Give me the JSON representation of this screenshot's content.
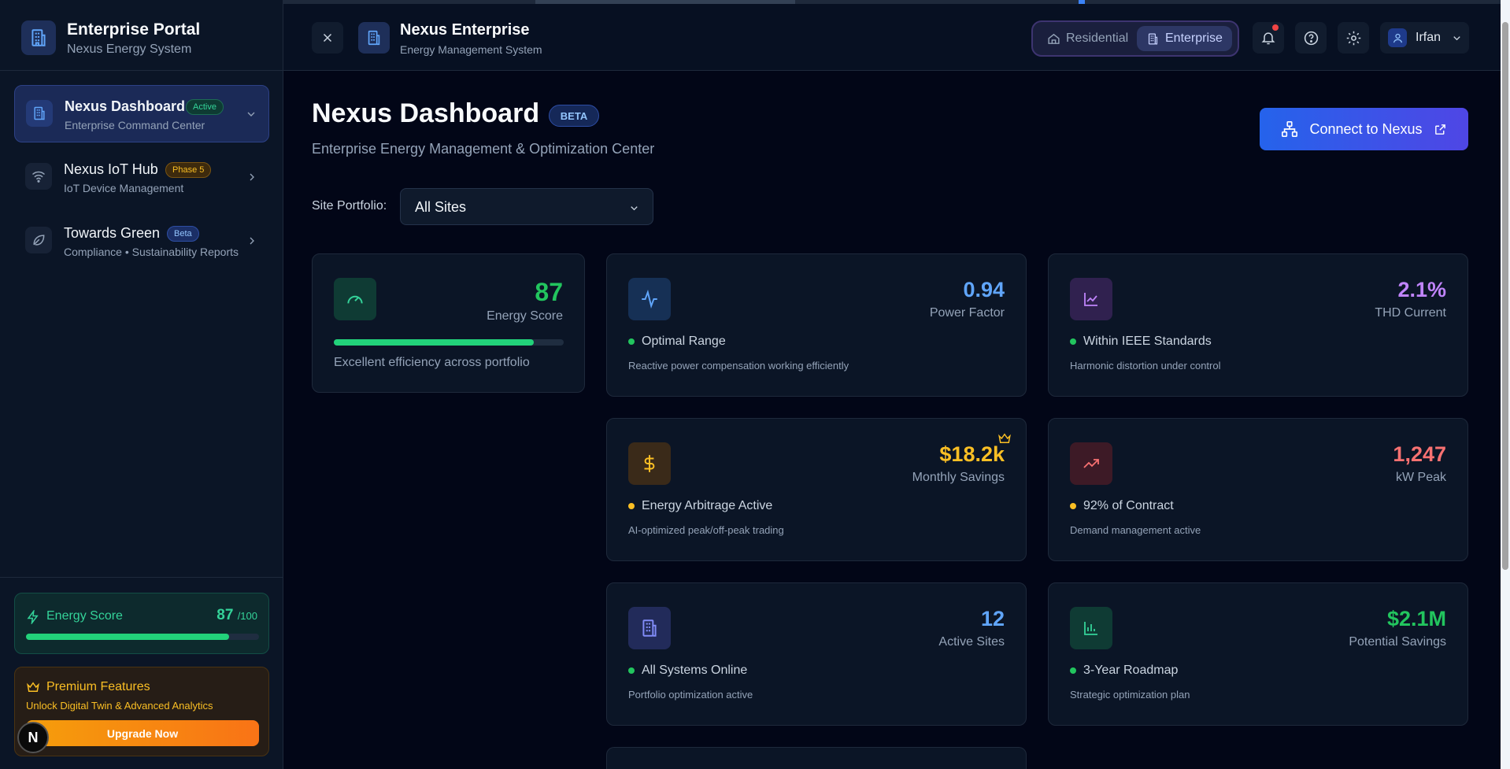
{
  "sidebar": {
    "title": "Enterprise Portal",
    "subtitle": "Nexus Energy System",
    "items": [
      {
        "label": "Nexus Dashboard",
        "badge": "Active",
        "desc": "Enterprise Command Center"
      },
      {
        "label": "Nexus IoT Hub",
        "badge": "Phase 5",
        "desc": "IoT Device Management"
      },
      {
        "label": "Towards Green",
        "badge": "Beta",
        "desc": "Compliance • Sustainability Reports"
      }
    ],
    "energy_score": {
      "label": "Energy Score",
      "value": "87",
      "max": "/100",
      "progress_pct": 87
    },
    "premium": {
      "title": "Premium Features",
      "desc": "Unlock Digital Twin & Advanced Analytics",
      "button": "Upgrade Now"
    },
    "avatar_letter": "N"
  },
  "header": {
    "title": "Nexus Enterprise",
    "subtitle": "Energy Management System",
    "modes": [
      "Residential",
      "Enterprise"
    ],
    "selected_mode": "Enterprise",
    "user": "Irfan"
  },
  "main": {
    "title": "Nexus Dashboard",
    "badge": "BETA",
    "subtitle": "Enterprise Energy Management & Optimization Center",
    "connect_button": "Connect to Nexus",
    "site_label": "Site Portfolio:",
    "site_value": "All Sites",
    "score_card": {
      "value": "87",
      "label": "Energy Score",
      "progress_pct": 87,
      "note": "Excellent efficiency across portfolio"
    },
    "cards": [
      {
        "value": "0.94",
        "label": "Power Factor",
        "status": "Optimal Range",
        "note": "Reactive power compensation working efficiently"
      },
      {
        "value": "2.1%",
        "label": "THD Current",
        "status": "Within IEEE Standards",
        "note": "Harmonic distortion under control"
      },
      {
        "value": "$18.2k",
        "label": "Monthly Savings",
        "status": "Energy Arbitrage Active",
        "note": "AI-optimized peak/off-peak trading"
      },
      {
        "value": "1,247",
        "label": "kW Peak",
        "status": "92% of Contract",
        "note": "Demand management active"
      },
      {
        "value": "12",
        "label": "Active Sites",
        "status": "All Systems Online",
        "note": "Portfolio optimization active"
      },
      {
        "value": "$2.1M",
        "label": "Potential Savings",
        "status": "3-Year Roadmap",
        "note": "Strategic optimization plan"
      }
    ]
  },
  "colors": {
    "accent_blue": "#3b82f6",
    "success_green": "#22c55e",
    "warning_amber": "#fbbf24",
    "danger_red": "#f87171",
    "purple": "#c084fc"
  }
}
